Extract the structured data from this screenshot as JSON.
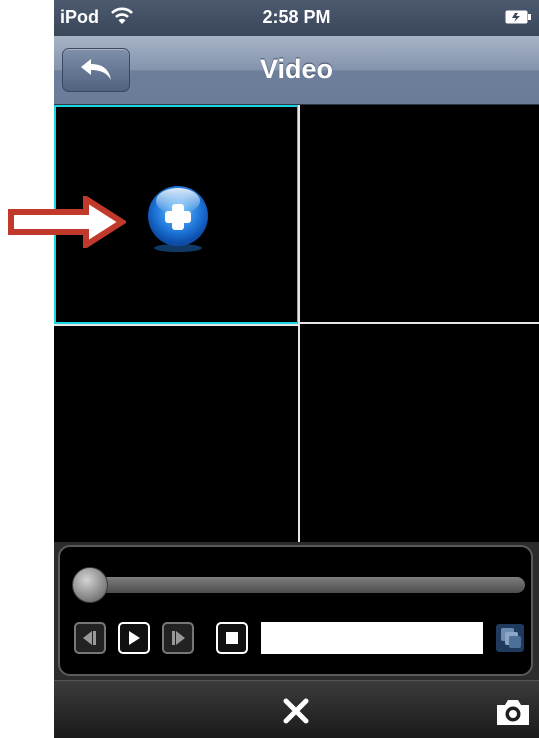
{
  "status_bar": {
    "carrier": "iPod",
    "time": "2:58 PM",
    "wifi_icon": "wifi-icon",
    "battery_icon": "battery-icon"
  },
  "nav": {
    "title": "Video",
    "back_icon": "back-arrow-icon"
  },
  "video_grid": {
    "selected_cell": 1,
    "cells": [
      {
        "add_icon": "add-channel-icon"
      },
      {},
      {},
      {}
    ],
    "selected_border_color": "#19d7e0"
  },
  "playback": {
    "progress": 0,
    "controls": [
      "step-back-icon",
      "play-icon",
      "step-forward-icon",
      "stop-icon",
      "layers-icon"
    ],
    "seek_value": ""
  },
  "bottom_bar": {
    "close_icon": "close-icon",
    "snapshot_icon": "camera-icon"
  },
  "annotation": {
    "arrow_icon": "pointer-arrow-icon",
    "arrow_color": "#c0392b"
  }
}
